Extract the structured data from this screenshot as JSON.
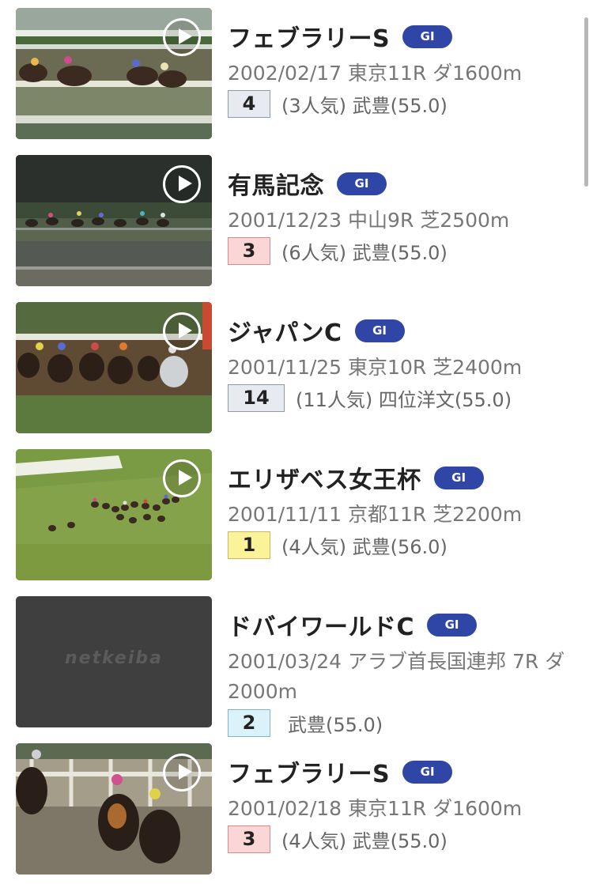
{
  "races": [
    {
      "name": "フェブラリーS",
      "grade": "GI",
      "meta": "2002/02/17 東京11R ダ1600m",
      "finish": "4",
      "popularity": "(3人気)",
      "jockey_weight": "武豊(55.0)",
      "finish_color": "#e7eaf0",
      "has_video": true
    },
    {
      "name": "有馬記念",
      "grade": "GI",
      "meta": "2001/12/23 中山9R 芝2500m",
      "finish": "3",
      "popularity": "(6人気)",
      "jockey_weight": "武豊(55.0)",
      "finish_color": "#fbd6d6",
      "has_video": true
    },
    {
      "name": "ジャパンC",
      "grade": "GI",
      "meta": "2001/11/25 東京10R 芝2400m",
      "finish": "14",
      "popularity": "(11人気)",
      "jockey_weight": "四位洋文(55.0)",
      "finish_color": "#e7eaf0",
      "has_video": true
    },
    {
      "name": "エリザベス女王杯",
      "grade": "GI",
      "meta": "2001/11/11 京都11R 芝2200m",
      "finish": "1",
      "popularity": "(4人気)",
      "jockey_weight": "武豊(56.0)",
      "finish_color": "#fbf29a",
      "has_video": true
    },
    {
      "name": "ドバイワールドC",
      "grade": "GI",
      "meta": "2001/03/24 アラブ首長国連邦 7R ダ2000m",
      "finish": "2",
      "popularity": "",
      "jockey_weight": "武豊(55.0)",
      "finish_color": "#dcf2fb",
      "has_video": false,
      "placeholder_logo": "netkeiba"
    },
    {
      "name": "フェブラリーS",
      "grade": "GI",
      "meta": "2001/02/18 東京11R ダ1600m",
      "finish": "3",
      "popularity": "(4人気)",
      "jockey_weight": "武豊(55.0)",
      "finish_color": "#fbd6d6",
      "has_video": true
    }
  ],
  "icons": {
    "play": "play-circle-icon",
    "badge": "grade-badge"
  },
  "colors": {
    "badge": "#2f46a7",
    "text": "#222222",
    "meta": "#777777"
  }
}
